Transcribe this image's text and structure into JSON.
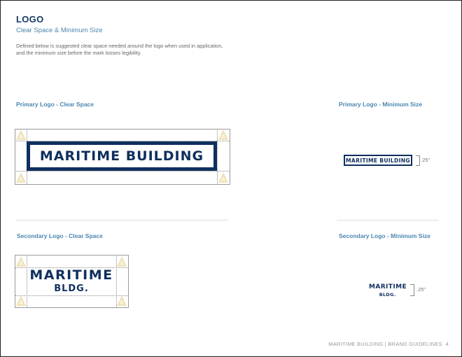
{
  "header": {
    "title": "LOGO",
    "subtitle": "Clear Space & Minimum Size",
    "description": "Defined below is suggested clear space needed around the logo when used in application, and the minimum size before the mark looses legibility."
  },
  "sections": {
    "primary_clear": {
      "label": "Primary Logo - Clear Space"
    },
    "primary_min": {
      "label": "Primary Logo - Minimum Size"
    },
    "secondary_clear": {
      "label": "Secondary Logo - Clear Space"
    },
    "secondary_min": {
      "label": "Secondary Logo - Minimum Size"
    }
  },
  "logo": {
    "primary_text": "MARITIME BUILDING",
    "secondary_line1": "MARITIME",
    "secondary_line2": "BLDG",
    "secondary_dot": ".",
    "unit_mark": "A"
  },
  "dimensions": {
    "primary_min_size": ".25\"",
    "secondary_min_size": ".25\""
  },
  "footer": {
    "text": "MARITIME BUILDING | BRAND GUIDELINES",
    "page_number": "4"
  },
  "colors": {
    "brand_navy": "#0f2f5e",
    "accent_blue": "#4a86b0",
    "unit_marker_gold": "#efe3b8"
  }
}
